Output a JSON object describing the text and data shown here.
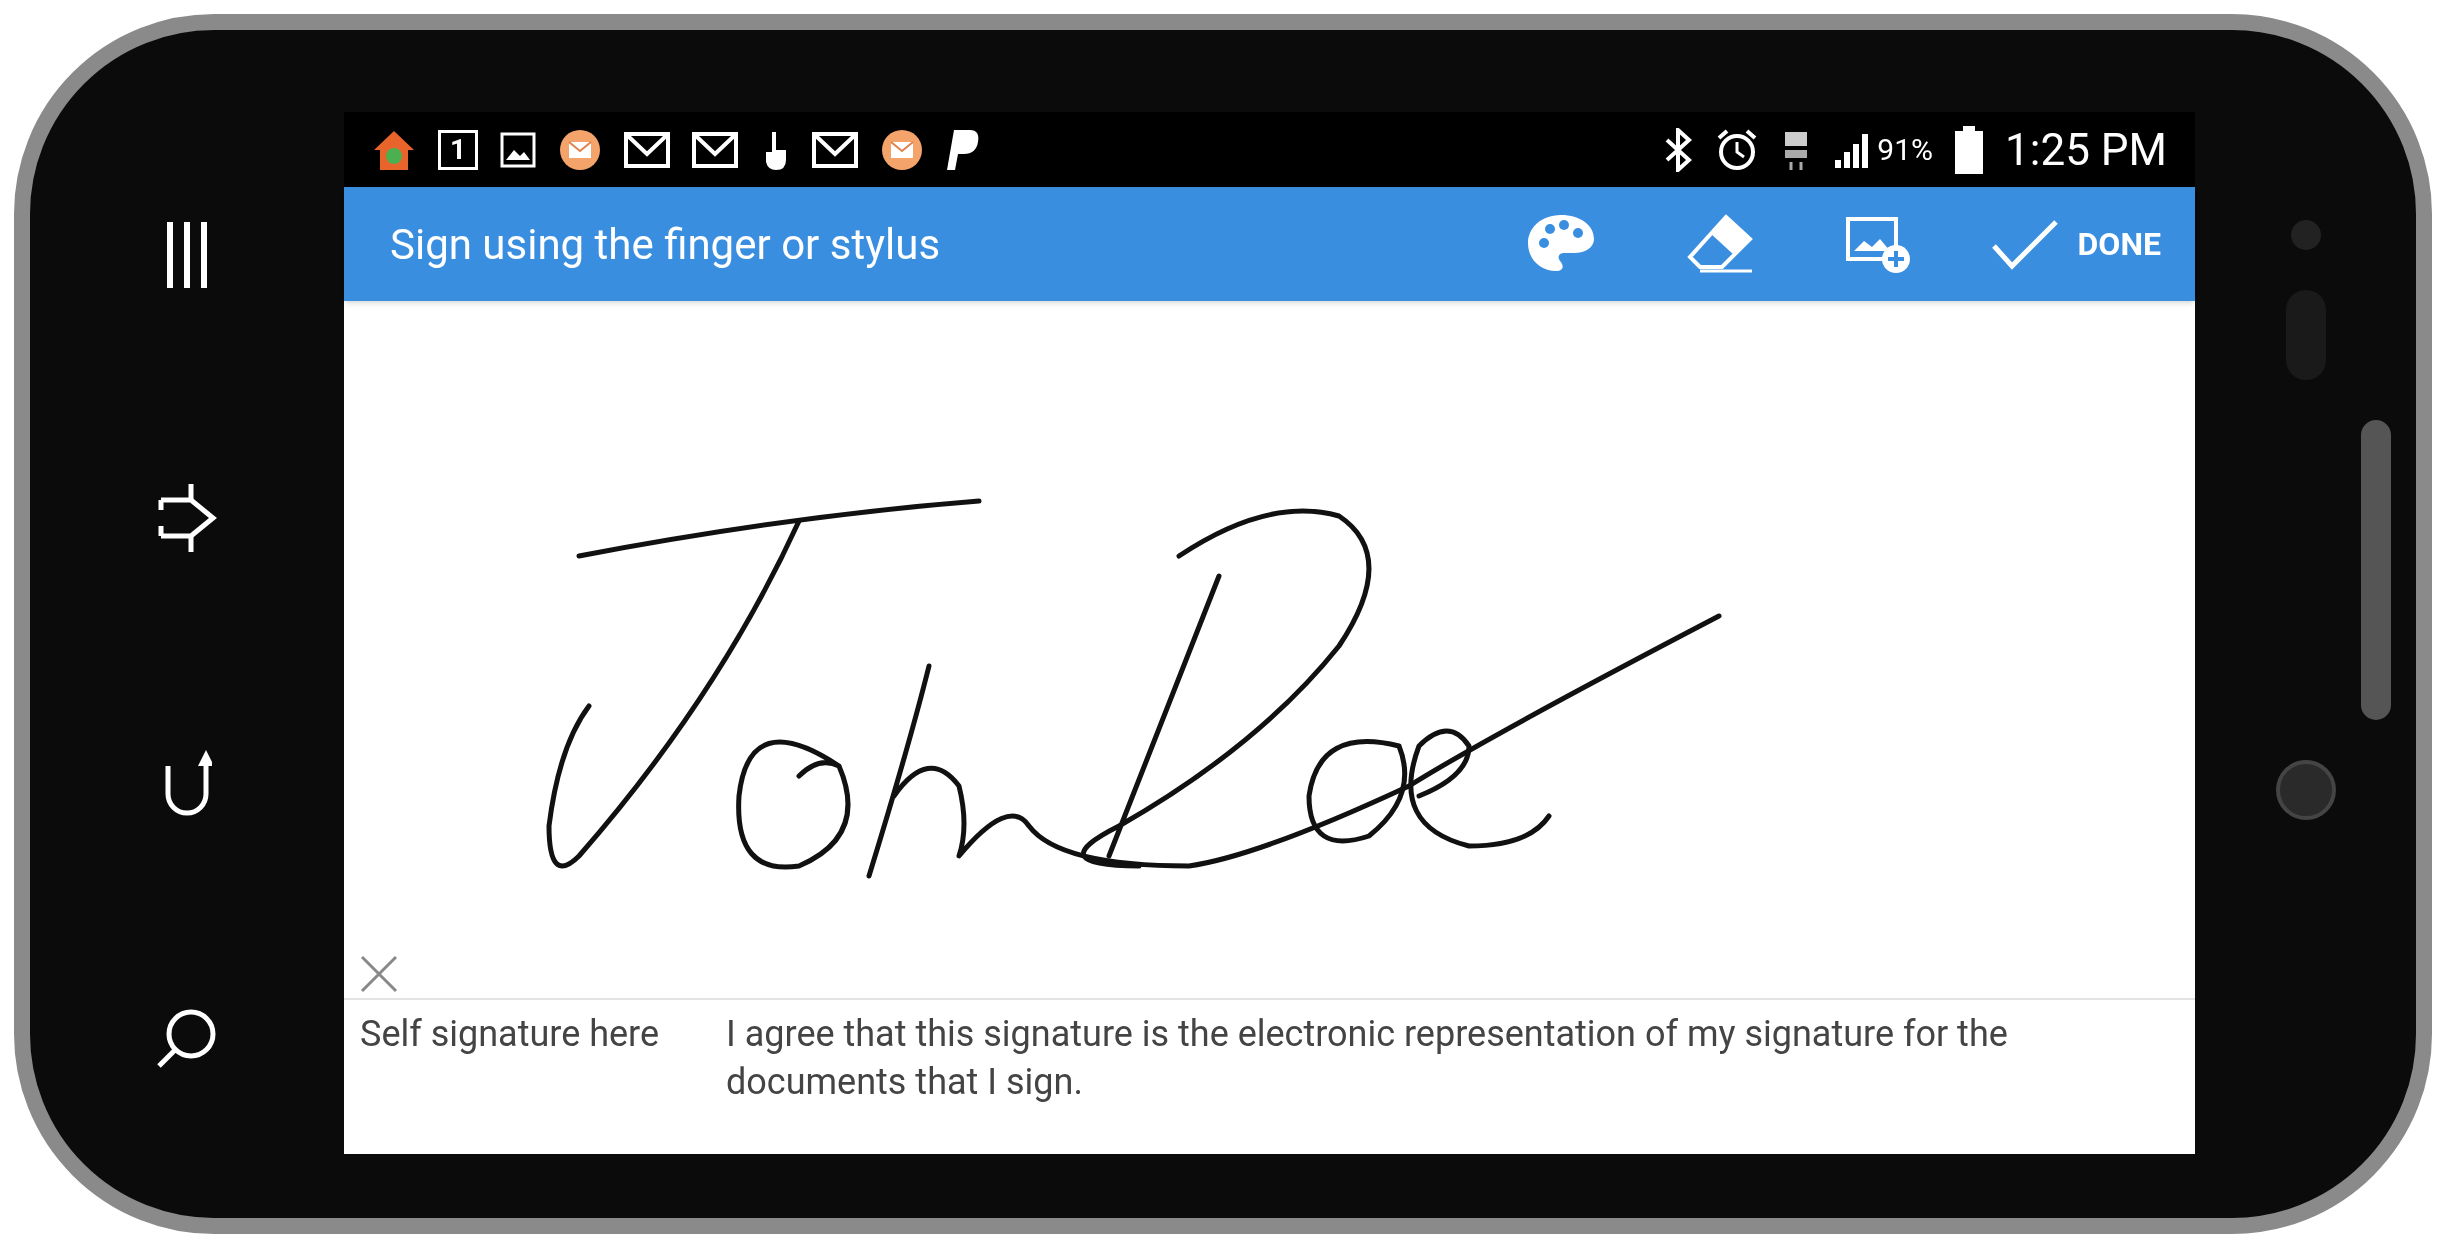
{
  "status_bar": {
    "calendar_day": "1",
    "battery": "91%",
    "time": "1:25 PM"
  },
  "app_bar": {
    "title": "Sign using the finger or stylus",
    "done": "DONE"
  },
  "footer": {
    "label": "Self signature here",
    "agreement": "I agree that this signature is the electronic representation of my signature for the documents that I sign."
  }
}
